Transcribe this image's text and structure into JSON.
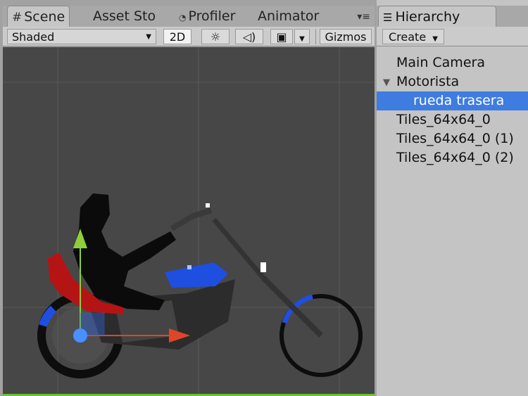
{
  "scene_tabs": [
    {
      "label": "Scene",
      "icon": "scene-grid-icon"
    },
    {
      "label": "Asset Sto",
      "icon": ""
    },
    {
      "label": "Profiler",
      "icon": "profiler-icon"
    },
    {
      "label": "Animator",
      "icon": ""
    }
  ],
  "scene_toolbar": {
    "draw_mode": "Shaded",
    "mode_2d": "2D",
    "gizmos": "Gizmos"
  },
  "hierarchy": {
    "tab_label": "Hierarchy",
    "create_label": "Create",
    "items": [
      {
        "label": "Main Camera",
        "level": 0,
        "expanded": null,
        "selected": false
      },
      {
        "label": "Motorista",
        "level": 0,
        "expanded": true,
        "selected": false
      },
      {
        "label": "rueda trasera",
        "level": 1,
        "expanded": null,
        "selected": true
      },
      {
        "label": "Tiles_64x64_0",
        "level": 0,
        "expanded": null,
        "selected": false
      },
      {
        "label": "Tiles_64x64_0 (1)",
        "level": 0,
        "expanded": null,
        "selected": false
      },
      {
        "label": "Tiles_64x64_0 (2)",
        "level": 0,
        "expanded": null,
        "selected": false
      }
    ]
  },
  "colors": {
    "selection": "#3e7ce0",
    "viewport_bg": "#474747",
    "gizmo_x": "#e0452a",
    "gizmo_y": "#8fd03a",
    "bike_accent": "#1f4fe0",
    "seat": "#b51414"
  }
}
